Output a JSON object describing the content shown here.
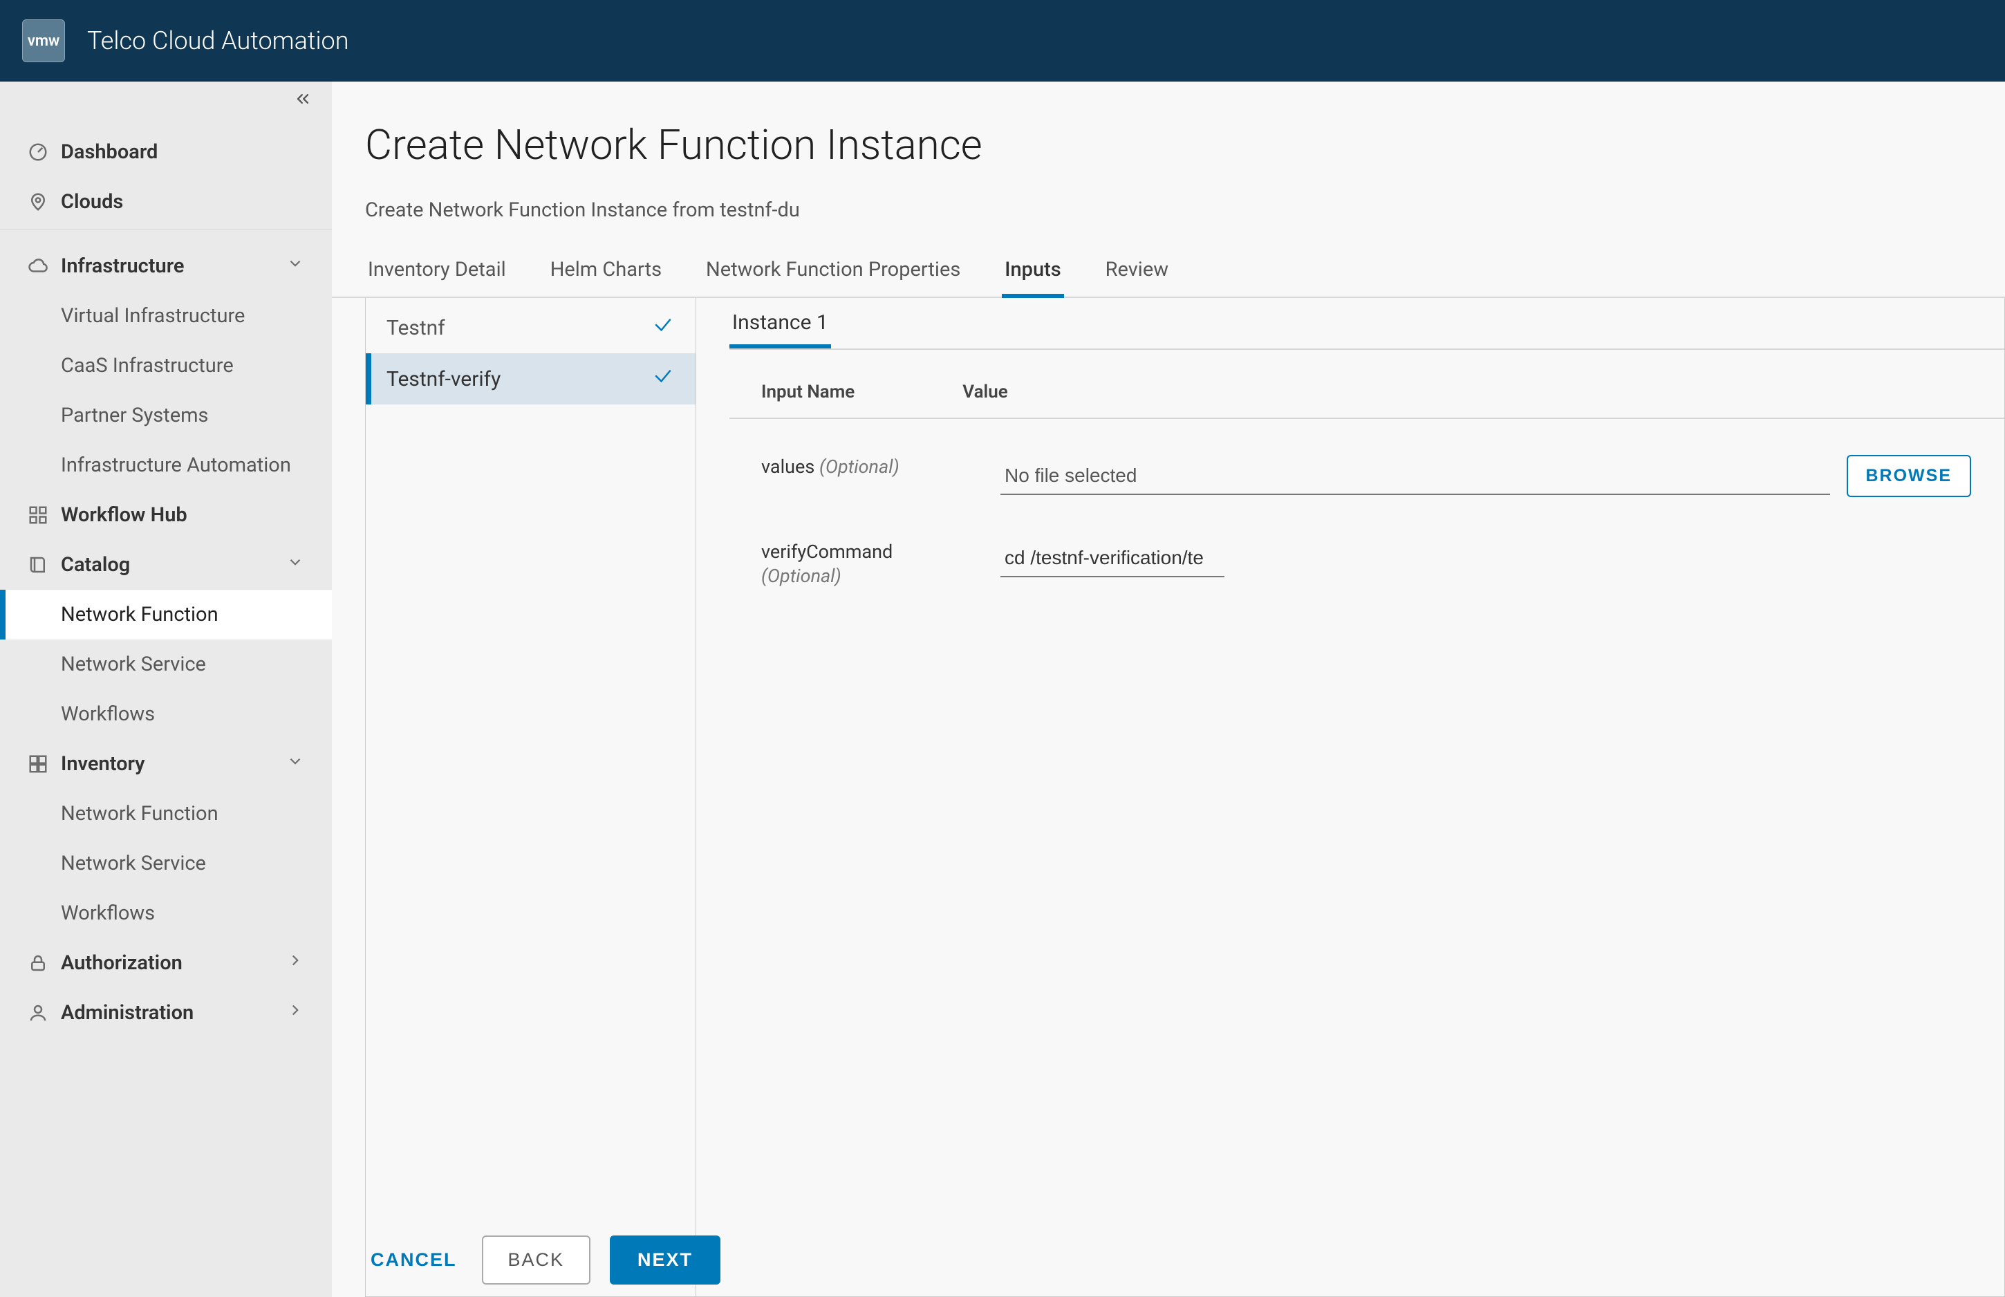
{
  "header": {
    "logo_text": "vmw",
    "product_name": "Telco Cloud Automation"
  },
  "sidebar": {
    "items": [
      {
        "label": "Dashboard",
        "icon": "gauge"
      },
      {
        "label": "Clouds",
        "icon": "pin"
      },
      {
        "label": "Infrastructure",
        "icon": "cloud",
        "expandable": true,
        "children": [
          {
            "label": "Virtual Infrastructure"
          },
          {
            "label": "CaaS Infrastructure"
          },
          {
            "label": "Partner Systems"
          },
          {
            "label": "Infrastructure Automation"
          }
        ]
      },
      {
        "label": "Workflow Hub",
        "icon": "grid"
      },
      {
        "label": "Catalog",
        "icon": "book",
        "expandable": true,
        "children": [
          {
            "label": "Network Function",
            "selected": true
          },
          {
            "label": "Network Service"
          },
          {
            "label": "Workflows"
          }
        ]
      },
      {
        "label": "Inventory",
        "icon": "boxes",
        "expandable": true,
        "children": [
          {
            "label": "Network Function"
          },
          {
            "label": "Network Service"
          },
          {
            "label": "Workflows"
          }
        ]
      },
      {
        "label": "Authorization",
        "icon": "lock",
        "expandable": true,
        "collapsed": true
      },
      {
        "label": "Administration",
        "icon": "user",
        "expandable": true,
        "collapsed": true
      }
    ]
  },
  "page": {
    "title": "Create Network Function Instance",
    "subtitle": "Create Network Function Instance from testnf-du",
    "tabs": [
      "Inventory Detail",
      "Helm Charts",
      "Network Function Properties",
      "Inputs",
      "Review"
    ],
    "active_tab_index": 3,
    "left_list": [
      {
        "label": "Testnf",
        "checked": true,
        "active": false
      },
      {
        "label": "Testnf-verify",
        "checked": true,
        "active": true
      }
    ],
    "inner_tab": "Instance 1",
    "col_headers": {
      "input_name": "Input Name",
      "value": "Value"
    },
    "fields": {
      "values": {
        "label": "values",
        "optional": "(Optional)",
        "file_text": "No file selected",
        "browse": "BROWSE"
      },
      "verify": {
        "label": "verifyCommand",
        "optional": "(Optional)",
        "value": "cd /testnf-verification/te"
      }
    },
    "buttons": {
      "cancel": "CANCEL",
      "back": "BACK",
      "next": "NEXT"
    }
  }
}
